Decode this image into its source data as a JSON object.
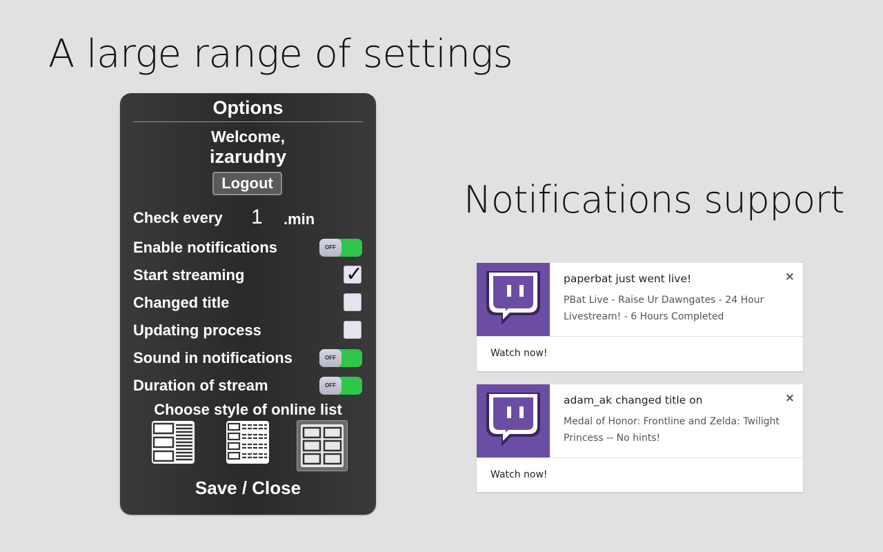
{
  "headlines": {
    "settings": "A large range of settings",
    "notifications": "Notifications support"
  },
  "options": {
    "title": "Options",
    "welcome": "Welcome,",
    "username": "izarudny",
    "logout_label": "Logout",
    "check_every_label": "Check every",
    "check_every_value": "1",
    "check_every_unit": ".min",
    "enable_notifications_label": "Enable notifications",
    "start_streaming_label": "Start streaming",
    "changed_title_label": "Changed title",
    "updating_process_label": "Updating process",
    "sound_label": "Sound in notifications",
    "duration_label": "Duration of stream",
    "toggle_off_text": "OFF",
    "choose_style_label": "Choose style of online list",
    "save_close_label": "Save / Close",
    "states": {
      "enable_notifications": "on",
      "start_streaming": true,
      "changed_title": false,
      "updating_process": false,
      "sound_in_notifications": "on",
      "duration_of_stream": "on",
      "selected_list_style": 3
    }
  },
  "notifications": [
    {
      "title": "paperbat just went live!",
      "body": "PBat Live - Raise Ur Dawngates - 24 Hour Livestream! -  6 Hours Completed",
      "close": "×",
      "action": "Watch now!"
    },
    {
      "title": "adam_ak changed title on",
      "body": "Medal of Honor: Frontline and Zelda: Twilight Princess -- No hints!",
      "close": "×",
      "action": "Watch now!"
    }
  ],
  "colors": {
    "background": "#e1e1e1",
    "panel": "#2e2e2e",
    "toggle_on": "#2fc64a",
    "twitch_purple": "#6b4da4"
  },
  "icons": {
    "notification_icon": "twitch-glitch-icon",
    "toggle": "toggle-switch",
    "list_styles": [
      "list-style-detailed-icon",
      "list-style-compact-icon",
      "list-style-grid-icon"
    ]
  }
}
